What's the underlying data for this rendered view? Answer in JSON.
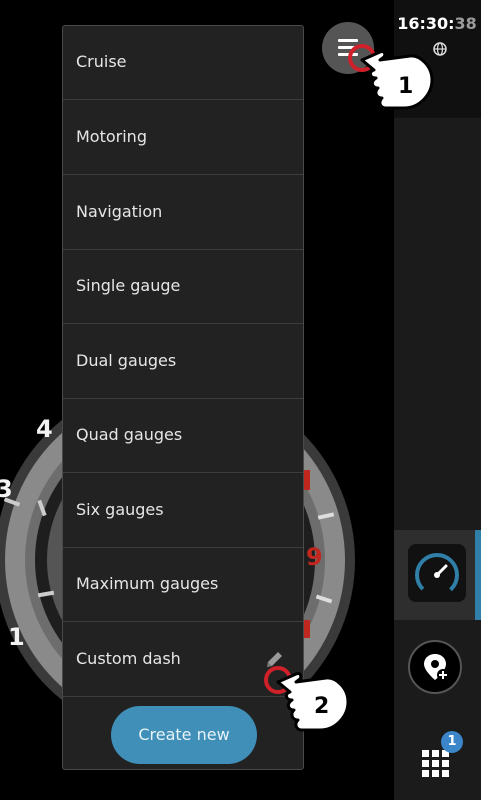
{
  "status": {
    "time_hm": "16:30:",
    "time_sec": "38"
  },
  "menu": {
    "items": [
      {
        "label": "Cruise"
      },
      {
        "label": "Motoring"
      },
      {
        "label": "Navigation"
      },
      {
        "label": "Single gauge"
      },
      {
        "label": "Dual gauges"
      },
      {
        "label": "Quad gauges"
      },
      {
        "label": "Six gauges"
      },
      {
        "label": "Maximum gauges"
      },
      {
        "label": "Custom dash"
      }
    ],
    "create_label": "Create new"
  },
  "gauge": {
    "labels": [
      "4",
      "3",
      "1",
      "9"
    ]
  },
  "apps": {
    "badge_count": "1"
  },
  "callouts": {
    "step1": "1",
    "step2": "2"
  },
  "colors": {
    "accent": "#3f8fb8",
    "badge": "#3a86c8",
    "callout_ring": "#d0202a",
    "gauge_red": "#c0271f"
  }
}
